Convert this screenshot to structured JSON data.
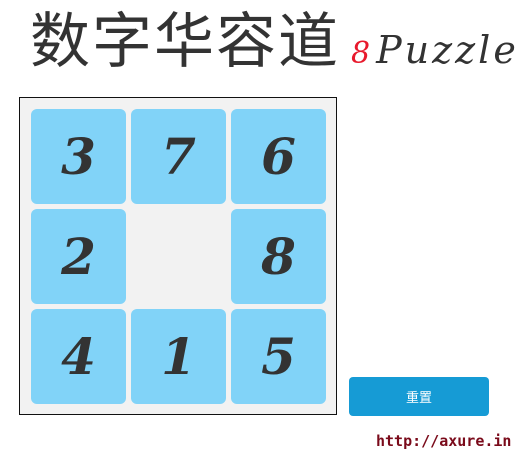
{
  "header": {
    "title_cn": "数字华容道",
    "title_num": "8",
    "title_word": "Puzzle"
  },
  "board": {
    "tiles": [
      {
        "value": "3",
        "row": 0,
        "col": 0
      },
      {
        "value": "7",
        "row": 0,
        "col": 1
      },
      {
        "value": "6",
        "row": 0,
        "col": 2
      },
      {
        "value": "2",
        "row": 1,
        "col": 0
      },
      {
        "value": "8",
        "row": 1,
        "col": 2
      },
      {
        "value": "4",
        "row": 2,
        "col": 0
      },
      {
        "value": "1",
        "row": 2,
        "col": 1
      },
      {
        "value": "5",
        "row": 2,
        "col": 2
      }
    ],
    "empty": {
      "row": 1,
      "col": 1
    },
    "tile_color": "#81d3f8",
    "board_color": "#f2f2f2"
  },
  "controls": {
    "reset_label": "重置",
    "reset_color": "#169bd5"
  },
  "footer": {
    "link_text": "http://axure.in",
    "link_color": "#7a0a1a"
  }
}
